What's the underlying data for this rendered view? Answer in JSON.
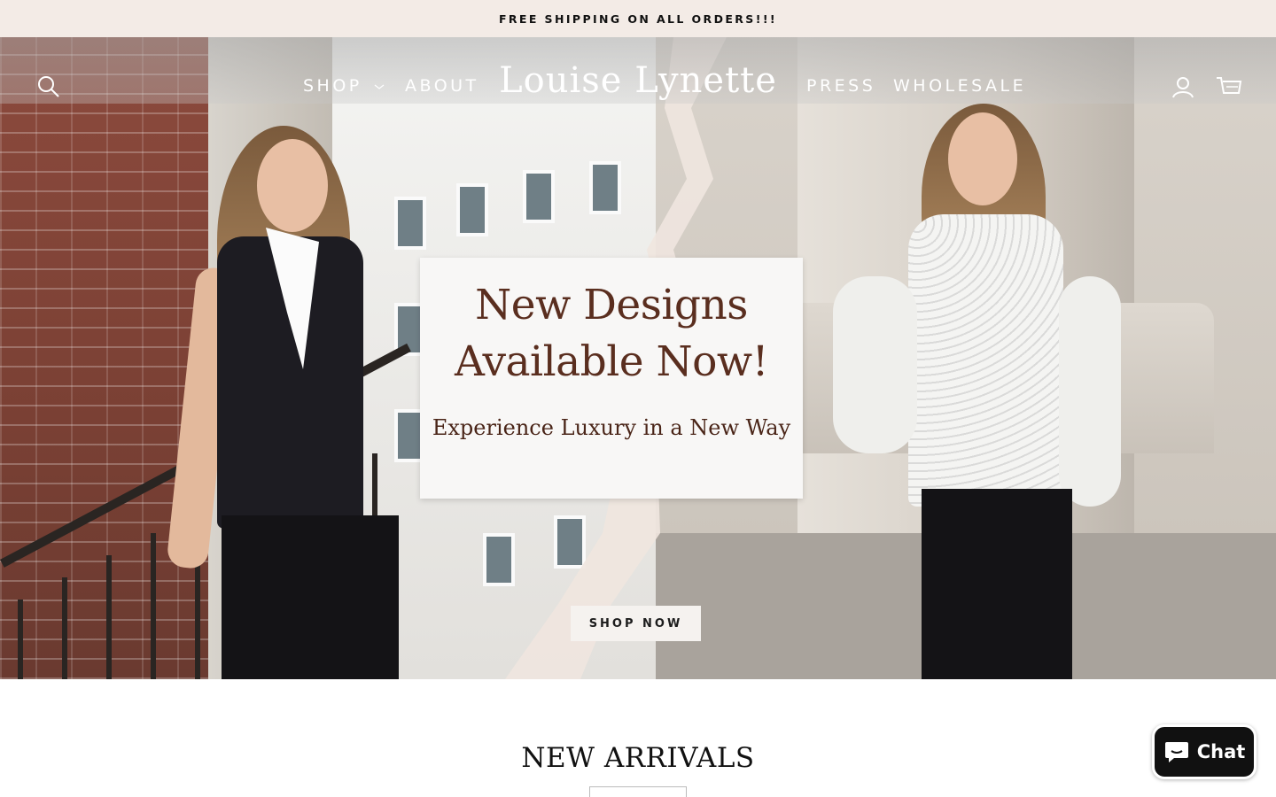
{
  "announcement": {
    "text": "FREE SHIPPING ON ALL ORDERS!!!"
  },
  "header": {
    "logo": "Louise Lynette",
    "nav": {
      "shop": "SHOP",
      "about": "ABOUT",
      "press": "PRESS",
      "wholesale": "WHOLESALE"
    },
    "icons": {
      "search": "search-icon",
      "account": "account-icon",
      "cart": "cart-icon",
      "shop_dropdown": "chevron-down-icon"
    }
  },
  "hero": {
    "headline_line1": "New Designs",
    "headline_line2": "Available Now!",
    "subheadline": "Experience Luxury in a New Way",
    "cta": "SHOP NOW"
  },
  "section": {
    "title": "NEW ARRIVALS"
  },
  "chat": {
    "label": "Chat",
    "icon": "chat-bubble-icon"
  },
  "colors": {
    "announcement_bg": "#f3ebe6",
    "card_text": "#5a2e1f",
    "chat_bg": "#111111"
  }
}
